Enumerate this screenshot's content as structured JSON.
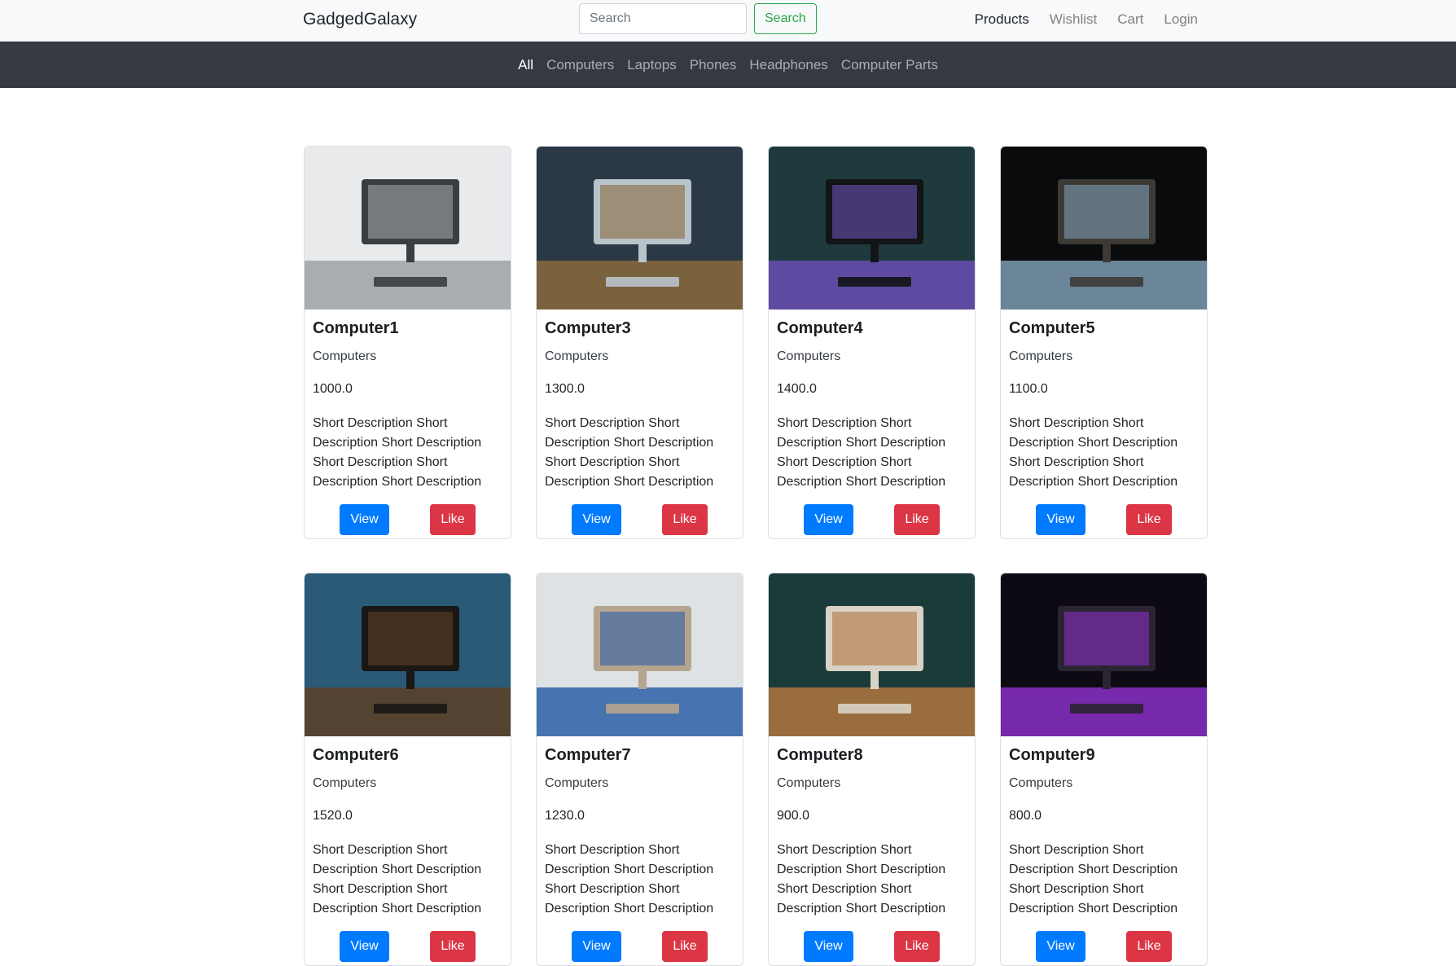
{
  "header": {
    "brand": "GadgedGalaxy",
    "search_placeholder": "Search",
    "search_button": "Search",
    "nav": [
      {
        "label": "Products",
        "active": true
      },
      {
        "label": "Wishlist",
        "active": false
      },
      {
        "label": "Cart",
        "active": false
      },
      {
        "label": "Login",
        "active": false
      }
    ]
  },
  "categories": [
    {
      "label": "All",
      "active": true
    },
    {
      "label": "Computers",
      "active": false
    },
    {
      "label": "Laptops",
      "active": false
    },
    {
      "label": "Phones",
      "active": false
    },
    {
      "label": "Headphones",
      "active": false
    },
    {
      "label": "Computer Parts",
      "active": false
    }
  ],
  "products": [
    {
      "name": "Computer1",
      "category": "Computers",
      "price": "1000.0",
      "description": "Short Description Short Description Short Description Short Description Short Description Short Description",
      "view_label": "View",
      "like_label": "Like",
      "image_colors": [
        "#e9eaec",
        "#9fa2a6",
        "#3a3d41"
      ]
    },
    {
      "name": "Computer3",
      "category": "Computers",
      "price": "1300.0",
      "description": "Short Description Short Description Short Description Short Description Short Description Short Description",
      "view_label": "View",
      "like_label": "Like",
      "image_colors": [
        "#2b3845",
        "#8a6a3e",
        "#b8c4cc"
      ]
    },
    {
      "name": "Computer4",
      "category": "Computers",
      "price": "1400.0",
      "description": "Short Description Short Description Short Description Short Description Short Description Short Description",
      "view_label": "View",
      "like_label": "Like",
      "image_colors": [
        "#1f3a3d",
        "#6a4fb3",
        "#121416"
      ]
    },
    {
      "name": "Computer5",
      "category": "Computers",
      "price": "1100.0",
      "description": "Short Description Short Description Short Description Short Description Short Description Short Description",
      "view_label": "View",
      "like_label": "Like",
      "image_colors": [
        "#0a0b0d",
        "#7d9bb3",
        "#3d3a36"
      ]
    },
    {
      "name": "Computer6",
      "category": "Computers",
      "price": "1520.0",
      "description": "Short Description Short Description Short Description Short Description Short Description Short Description",
      "view_label": "View",
      "like_label": "Like",
      "image_colors": [
        "#2a5a78",
        "#5d4026",
        "#1a1714"
      ]
    },
    {
      "name": "Computer7",
      "category": "Computers",
      "price": "1230.0",
      "description": "Short Description Short Description Short Description Short Description Short Description Short Description",
      "view_label": "View",
      "like_label": "Like",
      "image_colors": [
        "#dfe2e4",
        "#2e5fa8",
        "#b5a58e"
      ]
    },
    {
      "name": "Computer8",
      "category": "Computers",
      "price": "900.0",
      "description": "Short Description Short Description Short Description Short Description Short Description Short Description",
      "view_label": "View",
      "like_label": "Like",
      "image_colors": [
        "#1b3a3a",
        "#b0773f",
        "#d9d3c7"
      ]
    },
    {
      "name": "Computer9",
      "category": "Computers",
      "price": "800.0",
      "description": "Short Description Short Description Short Description Short Description Short Description Short Description",
      "view_label": "View",
      "like_label": "Like",
      "image_colors": [
        "#0d0a14",
        "#8a2fc4",
        "#2a2433"
      ]
    }
  ]
}
